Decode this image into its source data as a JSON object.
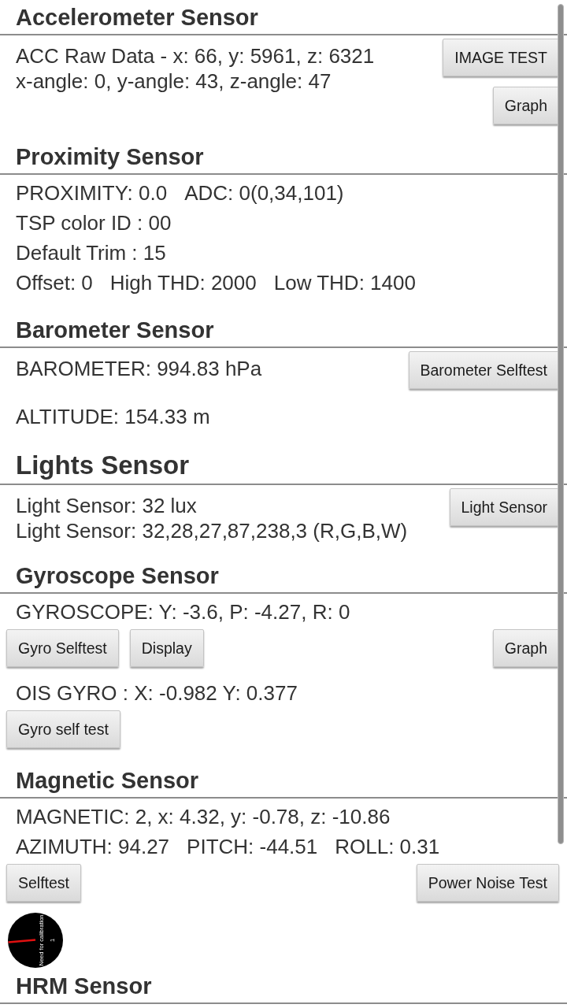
{
  "sections": [
    {
      "kind": "section",
      "title": "Accelerometer Sensor",
      "rows": [
        {
          "kind": "text_button",
          "texts": [
            "ACC Raw Data - x: 66, y: 5961, z: 6321",
            "x-angle: 0, y-angle: 43, z-angle: 47"
          ],
          "buttons": [
            "IMAGE TEST",
            "Graph"
          ]
        }
      ]
    },
    {
      "kind": "section",
      "title": "Proximity Sensor",
      "rows": [
        {
          "kind": "text",
          "texts": [
            "PROXIMITY: 0.0",
            "ADC: 0(0,34,101)"
          ]
        },
        {
          "kind": "text",
          "texts": [
            "TSP color ID : 00"
          ]
        },
        {
          "kind": "text",
          "texts": [
            "Default Trim : 15"
          ]
        },
        {
          "kind": "text",
          "texts": [
            "Offset: 0",
            "High THD: 2000",
            "Low THD: 1400"
          ]
        }
      ]
    },
    {
      "kind": "section",
      "title": "Barometer Sensor",
      "rows": [
        {
          "kind": "text_button",
          "texts": [
            "BAROMETER: 994.83 hPa"
          ],
          "buttons": [
            "Barometer Selftest"
          ]
        },
        {
          "kind": "text",
          "texts": [
            "ALTITUDE: 154.33 m"
          ]
        }
      ]
    },
    {
      "kind": "large_section",
      "title": "Lights Sensor",
      "rows": [
        {
          "kind": "text_button",
          "texts": [
            "Light Sensor: 32 lux",
            "Light Sensor: 32,28,27,87,238,3 (R,G,B,W)"
          ],
          "buttons": [
            "Light Sensor"
          ]
        }
      ]
    },
    {
      "kind": "section",
      "title": "Gyroscope Sensor",
      "rows": [
        {
          "kind": "text",
          "texts": [
            "GYROSCOPE: Y: -3.6, P: -4.27, R: 0"
          ]
        },
        {
          "kind": "buttons",
          "left": [
            "Gyro Selftest",
            "Display"
          ],
          "right": [
            "Graph"
          ]
        },
        {
          "kind": "text",
          "texts": [
            "OIS GYRO : X: -0.982 Y: 0.377"
          ]
        },
        {
          "kind": "buttons",
          "left": [
            "Gyro self test"
          ]
        }
      ]
    },
    {
      "kind": "section",
      "title": "Magnetic Sensor",
      "rows": [
        {
          "kind": "text",
          "texts": [
            "MAGNETIC: 2, x: 4.32, y: -0.78, z: -10.86"
          ]
        },
        {
          "kind": "text",
          "texts": [
            "AZIMUTH: 94.27",
            "PITCH: -44.51",
            "ROLL: 0.31"
          ]
        },
        {
          "kind": "buttons",
          "left": [
            "Selftest"
          ],
          "right": [
            "Power Noise Test"
          ]
        },
        {
          "kind": "compass",
          "status": "Need for calibration",
          "accuracy": "1"
        }
      ]
    },
    {
      "kind": "section",
      "title": "HRM Sensor"
    }
  ]
}
